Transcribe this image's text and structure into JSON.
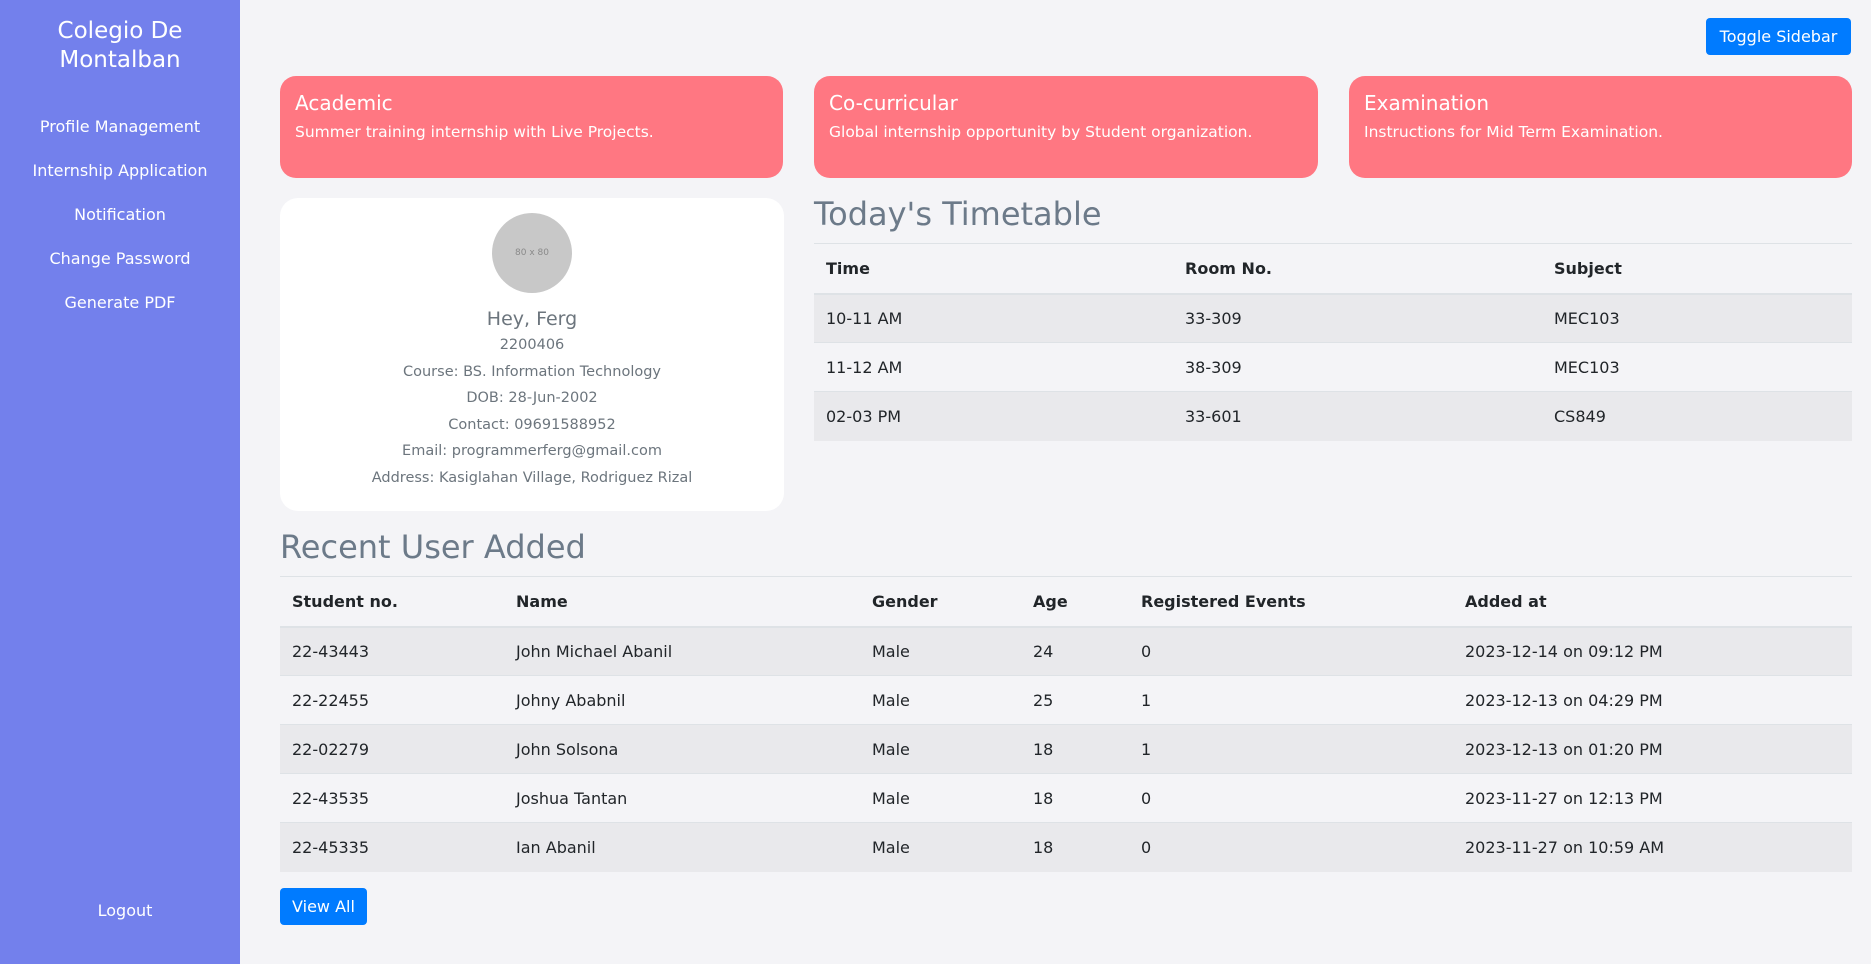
{
  "sidebar": {
    "brand": "Colegio De Montalban",
    "items": [
      {
        "label": "Profile Management"
      },
      {
        "label": "Internship Application"
      },
      {
        "label": "Notification"
      },
      {
        "label": "Change Password"
      },
      {
        "label": "Generate PDF"
      }
    ],
    "logout": "Logout"
  },
  "header": {
    "toggle_label": "Toggle Sidebar"
  },
  "cards": [
    {
      "title": "Academic",
      "text": "Summer training internship with Live Projects."
    },
    {
      "title": "Co-curricular",
      "text": "Global internship opportunity by Student organization."
    },
    {
      "title": "Examination",
      "text": "Instructions for Mid Term Examination."
    }
  ],
  "profile": {
    "avatar_text": "80 x 80",
    "greeting": "Hey, Ferg",
    "student_id": "2200406",
    "course": "Course: BS. Information Technology",
    "dob": "DOB: 28-Jun-2002",
    "contact": "Contact: 09691588952",
    "email": "Email: programmerferg@gmail.com",
    "address": "Address: Kasiglahan Village, Rodriguez Rizal"
  },
  "timetable": {
    "title": "Today's Timetable",
    "headers": [
      "Time",
      "Room No.",
      "Subject"
    ],
    "rows": [
      [
        "10-11 AM",
        "33-309",
        "MEC103"
      ],
      [
        "11-12 AM",
        "38-309",
        "MEC103"
      ],
      [
        "02-03 PM",
        "33-601",
        "CS849"
      ]
    ]
  },
  "recent": {
    "title": "Recent User Added",
    "headers": [
      "Student no.",
      "Name",
      "Gender",
      "Age",
      "Registered Events",
      "Added at"
    ],
    "rows": [
      [
        "22-43443",
        "John Michael Abanil",
        "Male",
        "24",
        "0",
        "2023-12-14 on 09:12 PM"
      ],
      [
        "22-22455",
        "Johny Ababnil",
        "Male",
        "25",
        "1",
        "2023-12-13 on 04:29 PM"
      ],
      [
        "22-02279",
        "John Solsona",
        "Male",
        "18",
        "1",
        "2023-12-13 on 01:20 PM"
      ],
      [
        "22-43535",
        "Joshua Tantan",
        "Male",
        "18",
        "0",
        "2023-11-27 on 12:13 PM"
      ],
      [
        "22-45335",
        "Ian Abanil",
        "Male",
        "18",
        "0",
        "2023-11-27 on 10:59 AM"
      ]
    ],
    "view_all": "View All"
  }
}
